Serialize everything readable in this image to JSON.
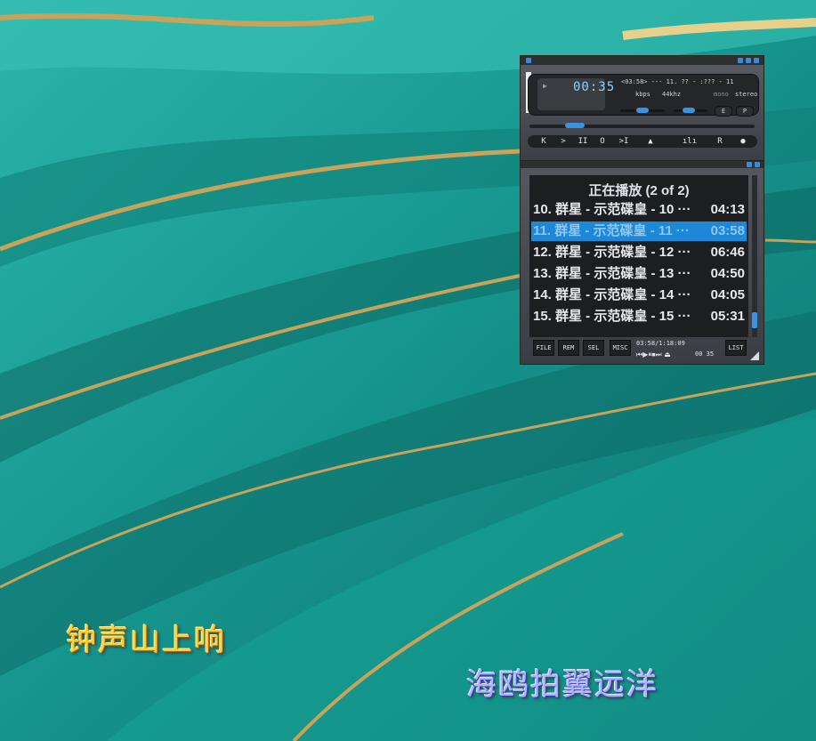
{
  "colors": {
    "desktop_teal": "#1aa39a",
    "accent_blue": "#1e88d8",
    "gold_stripe": "#c9a35a"
  },
  "player": {
    "elapsed": "00:35",
    "ticker": "<03:58> --- 11. ?? - :??? - 11",
    "bitrate_unit": "kbps",
    "sample_rate": "44khz",
    "mode_mono": "mono",
    "mode_stereo": "stereo",
    "eq_label": "E",
    "pl_label": "P",
    "controls": {
      "prev": "K",
      "play": ">",
      "pause": "II",
      "stop": "O",
      "next": ">I",
      "eject": "▲",
      "eq": "ılı",
      "repeat": "R",
      "shuffle": "●"
    }
  },
  "playlist": {
    "header": "正在播放 (2 of 2)",
    "items": [
      {
        "title": "10. 群星 - 示范碟皇 - 10 ···",
        "duration": "04:13",
        "selected": false
      },
      {
        "title": "11. 群星 - 示范碟皇 - 11 ···",
        "duration": "03:58",
        "selected": true
      },
      {
        "title": "12. 群星 - 示范碟皇 - 12 ···",
        "duration": "06:46",
        "selected": false
      },
      {
        "title": "13. 群星 - 示范碟皇 - 13 ···",
        "duration": "04:50",
        "selected": false
      },
      {
        "title": "14. 群星 - 示范碟皇 - 14 ···",
        "duration": "04:05",
        "selected": false
      },
      {
        "title": "15. 群星 - 示范碟皇 - 15 ···",
        "duration": "05:31",
        "selected": false
      }
    ],
    "buttons": {
      "file": "FILE",
      "rem": "REM",
      "sel": "SEL",
      "misc": "MISC",
      "list": "LIST"
    },
    "status": "03:58/1:18:09",
    "mini_controls": "⏮▶⏸⏹⏭ ⏏",
    "mini_time": "00 35"
  },
  "lyrics": {
    "line1": "钟声山上响",
    "line2": "海鸥拍翼远洋"
  }
}
